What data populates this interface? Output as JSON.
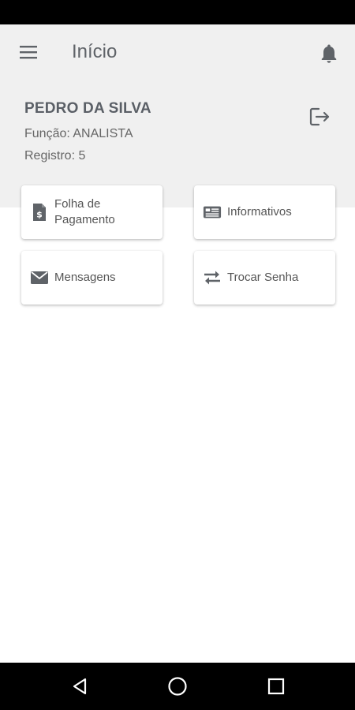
{
  "app_bar": {
    "title": "Início"
  },
  "user": {
    "name": "PEDRO DA SILVA",
    "role": "Função: ANALISTA",
    "registration": "Registro: 5"
  },
  "cards": [
    {
      "label": "Folha de Pagamento",
      "icon": "payroll-document-icon"
    },
    {
      "label": "Informativos",
      "icon": "newspaper-icon"
    },
    {
      "label": "Mensagens",
      "icon": "envelope-icon"
    },
    {
      "label": "Trocar Senha",
      "icon": "swap-arrows-icon"
    }
  ],
  "colors": {
    "header_bg": "#f0f0f0",
    "icon": "#5f6368",
    "text": "#555555"
  }
}
